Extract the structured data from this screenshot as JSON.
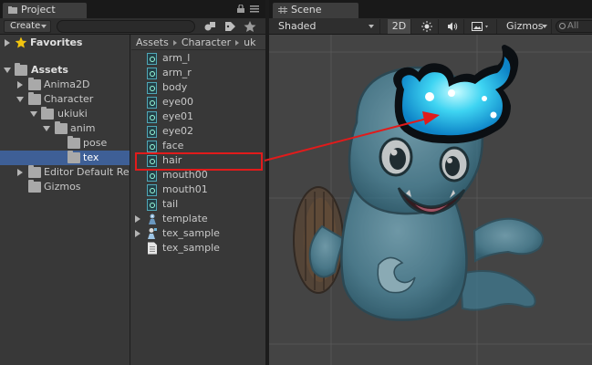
{
  "project": {
    "tab_label": "Project",
    "create_label": "Create",
    "tree": [
      {
        "label": "Favorites",
        "bold": true,
        "expanded": false,
        "icon": "star-icon"
      },
      {
        "label": "Assets",
        "bold": true,
        "expanded": true,
        "icon": "folder-icon"
      },
      {
        "label": "Anima2D",
        "expanded": false,
        "icon": "folder-icon"
      },
      {
        "label": "Character",
        "expanded": true,
        "icon": "folder-icon"
      },
      {
        "label": "ukiuki",
        "expanded": true,
        "icon": "folder-icon"
      },
      {
        "label": "anim",
        "expanded": true,
        "icon": "folder-icon"
      },
      {
        "label": "pose",
        "icon": "folder-icon"
      },
      {
        "label": "tex",
        "icon": "folder-icon",
        "selected": true
      },
      {
        "label": "Editor Default Re",
        "expanded": false,
        "icon": "folder-icon"
      },
      {
        "label": "Gizmos",
        "icon": "folder-icon"
      }
    ],
    "breadcrumb": [
      "Assets",
      "Character",
      "uk"
    ],
    "assets": [
      {
        "label": "arm_l",
        "icon": "sprite-icon"
      },
      {
        "label": "arm_r",
        "icon": "sprite-icon"
      },
      {
        "label": "body",
        "icon": "sprite-icon"
      },
      {
        "label": "eye00",
        "icon": "sprite-icon"
      },
      {
        "label": "eye01",
        "icon": "sprite-icon"
      },
      {
        "label": "eye02",
        "icon": "sprite-icon"
      },
      {
        "label": "face",
        "icon": "sprite-icon"
      },
      {
        "label": "hair",
        "icon": "sprite-icon",
        "highlighted": true
      },
      {
        "label": "mouth00",
        "icon": "sprite-icon"
      },
      {
        "label": "mouth01",
        "icon": "sprite-icon"
      },
      {
        "label": "tail",
        "icon": "sprite-icon"
      },
      {
        "label": "template",
        "icon": "prefab-icon",
        "expandable": true
      },
      {
        "label": "tex_sample",
        "icon": "sprite-sheet-icon",
        "expandable": true
      },
      {
        "label": "tex_sample",
        "icon": "text-file-icon"
      }
    ]
  },
  "scene": {
    "tab_label": "Scene",
    "shading_mode": "Shaded",
    "mode_2d_label": "2D",
    "gizmos_label": "Gizmos",
    "search_placeholder": "All"
  },
  "colors": {
    "selection": "#3e5f96",
    "annotation": "#e11b1b",
    "sprite_icon": "#4fa7b7"
  }
}
